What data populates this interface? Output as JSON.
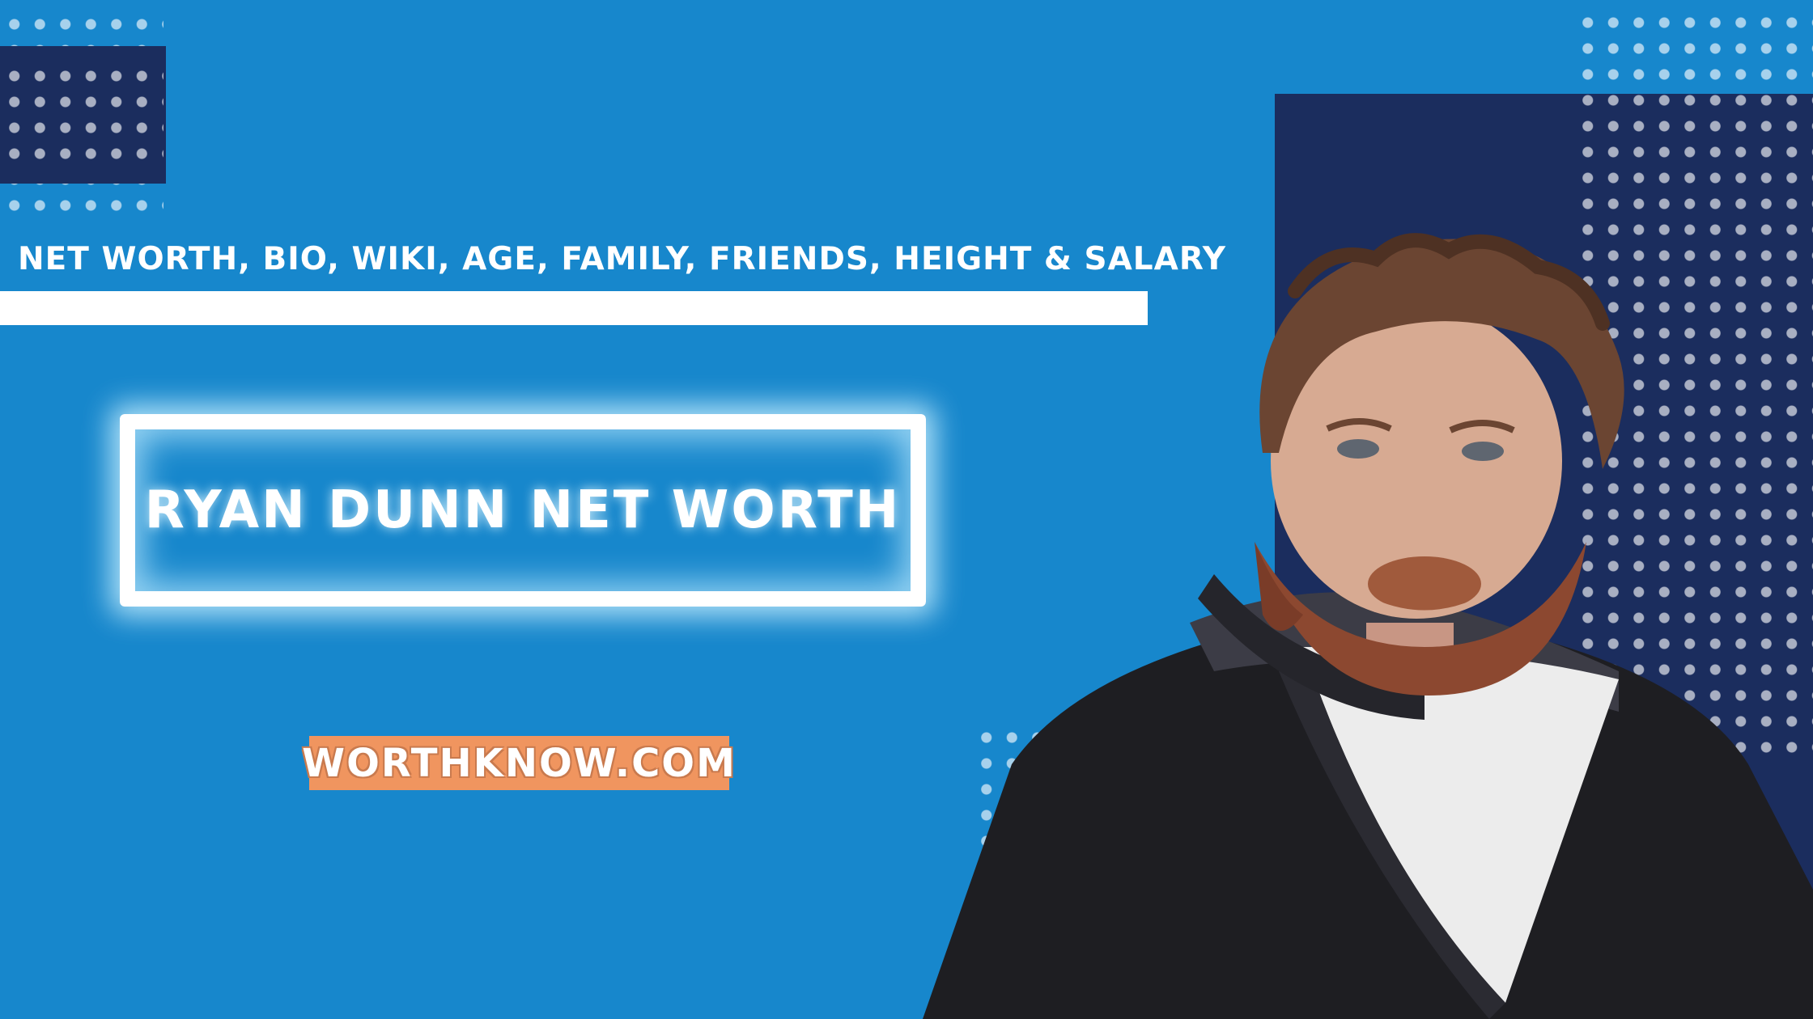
{
  "subtitle": "NET WORTH, BIO, WIKI, AGE, FAMILY, FRIENDS, HEIGHT & SALARY",
  "title": "RYAN DUNN NET WORTH",
  "site": "WORTHKNOW.COM",
  "colors": {
    "background": "#1787cc",
    "dark_panel": "#1b2d5e",
    "badge": "#f0955f",
    "text": "#ffffff"
  }
}
